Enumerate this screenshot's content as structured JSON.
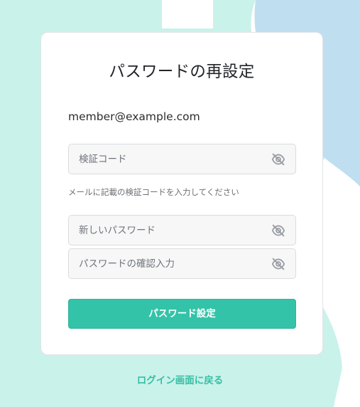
{
  "colors": {
    "accent": "#33c3a8",
    "background_mint": "#c9f2ea",
    "background_blue": "#bfdff0",
    "link": "#36bfa3"
  },
  "form": {
    "title": "パスワードの再設定",
    "email": "member@example.com",
    "verification_code": {
      "placeholder": "検証コード",
      "value": "",
      "icon": "eye-off-icon"
    },
    "hint": "メールに記載の検証コードを入力してください",
    "new_password": {
      "placeholder": "新しいパスワード",
      "value": "",
      "icon": "eye-off-icon"
    },
    "confirm_password": {
      "placeholder": "パスワードの確認入力",
      "value": "",
      "icon": "eye-off-icon"
    },
    "submit_label": "パスワード設定"
  },
  "footer": {
    "back_link_label": "ログイン画面に戻る"
  }
}
